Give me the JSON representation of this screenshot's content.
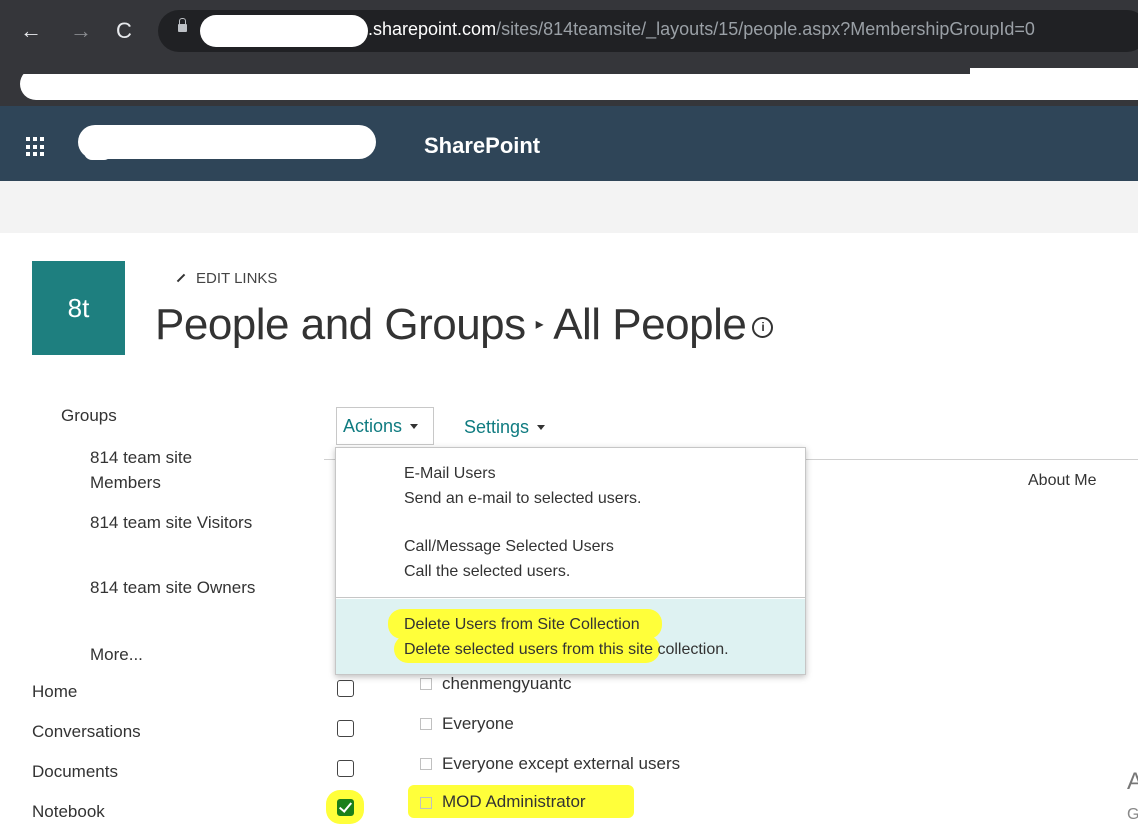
{
  "browser": {
    "back_glyph": "←",
    "forward_glyph": "→",
    "reload_glyph": "C",
    "url_host": ".sharepoint.com",
    "url_path": "/sites/814teamsite/_layouts/15/people.aspx?MembershipGroupId=0"
  },
  "suite": {
    "title": "SharePoint"
  },
  "site": {
    "logo_text": "8t",
    "edit_links": "EDIT LINKS",
    "title_part1": "People and Groups",
    "title_sep": "▸",
    "title_part2": "All People",
    "info_glyph": "i"
  },
  "nav": {
    "groups_heading": "Groups",
    "group_items": [
      {
        "label": "814 team site Members"
      },
      {
        "label": "814 team site Visitors"
      },
      {
        "label": "814 team site Owners"
      },
      {
        "label": "More..."
      }
    ],
    "root_items": [
      {
        "label": "Home"
      },
      {
        "label": "Conversations"
      },
      {
        "label": "Documents"
      },
      {
        "label": "Notebook"
      }
    ]
  },
  "toolbar": {
    "actions_label": "Actions",
    "settings_label": "Settings",
    "column_about": "About Me"
  },
  "menu": {
    "items": [
      {
        "title": "E-Mail Users",
        "desc": "Send an e-mail to selected users."
      },
      {
        "title": "Call/Message Selected Users",
        "desc": "Call the selected users."
      },
      {
        "title": "Delete Users from Site Collection",
        "desc": "Delete selected users from this site collection."
      }
    ],
    "highlighted_index": 2
  },
  "users": [
    {
      "name": "chenmengyuantc",
      "checked": false
    },
    {
      "name": "Everyone",
      "checked": false
    },
    {
      "name": "Everyone except external users",
      "checked": false
    },
    {
      "name": "MOD Administrator",
      "checked": true
    }
  ],
  "edge": {
    "letter_a": "A",
    "letter_g": "G"
  },
  "colors": {
    "suite_bar": "#2f4558",
    "logo": "#1e7f7f",
    "link": "#0f7b80",
    "highlight": "#ffff3a",
    "menu_hover": "#def2f2"
  }
}
